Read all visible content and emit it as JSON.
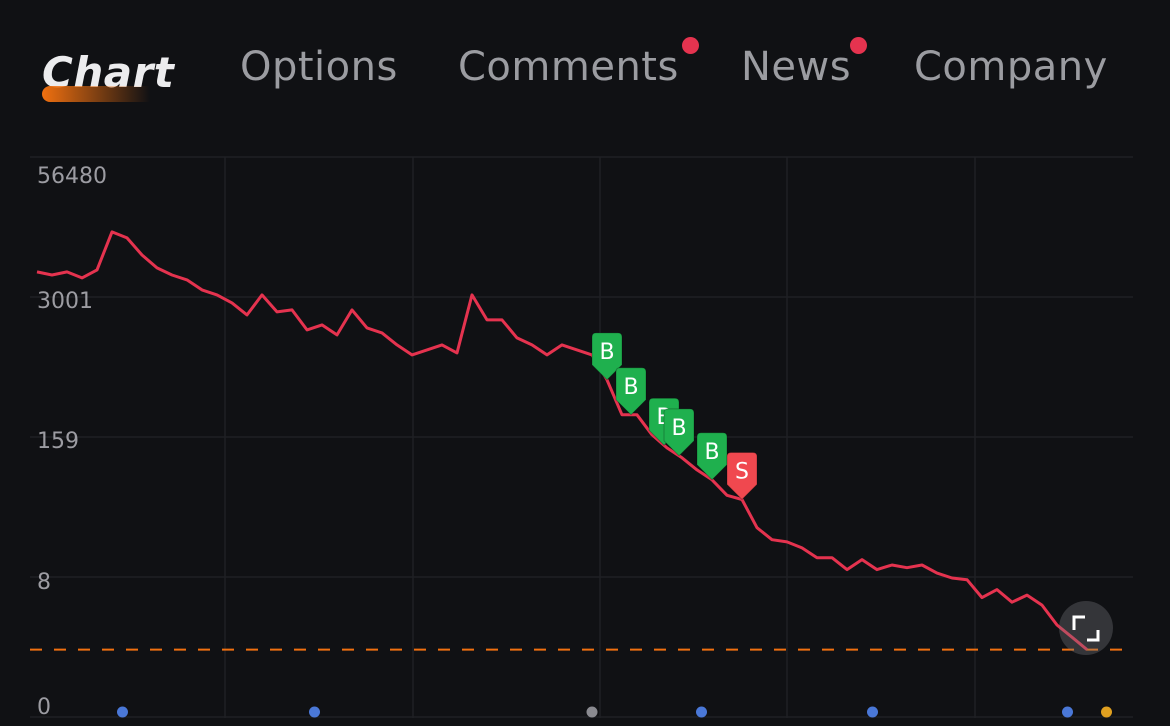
{
  "tabs": [
    {
      "label": "Chart",
      "active": true,
      "badge": false
    },
    {
      "label": "Options",
      "active": false,
      "badge": false
    },
    {
      "label": "Comments",
      "active": false,
      "badge": true
    },
    {
      "label": "News",
      "active": false,
      "badge": true
    },
    {
      "label": "Company",
      "active": false,
      "badge": false
    }
  ],
  "colors": {
    "line": "#e5334f",
    "buy": "#1fb04e",
    "sell": "#f0484f",
    "accent": "#f07010",
    "badge": "#e5334f",
    "grid": "#1f2024"
  },
  "fullscreen_button": {
    "icon": "expand-icon"
  },
  "chart_data": {
    "type": "line",
    "y_scale": "log",
    "y_ticks": [
      "56480",
      "3001",
      "159",
      "8",
      "0"
    ],
    "grid": true,
    "series": [
      {
        "values": [
          5075,
          4764,
          5075,
          4477,
          5297,
          11736,
          10350,
          7244,
          5521,
          4764,
          4294,
          3483,
          3134,
          2650,
          2061,
          3134,
          2195,
          2291,
          1506,
          1671,
          1355,
          2291,
          1570,
          1413,
          1099,
          891,
          990,
          1099,
          929,
          3134,
          1858,
          1858,
          1274,
          1099,
          891,
          1099,
          990,
          891,
          528,
          254,
          254,
          167,
          127,
          103,
          80,
          65,
          47,
          43,
          23.8,
          18.5,
          17.7,
          15.6,
          12.7,
          12.7,
          9.9,
          12.2,
          9.9,
          10.9,
          10.3,
          10.9,
          9.2,
          8.3,
          8.0,
          5.5,
          6.5,
          5.0,
          5.8,
          4.7,
          3.1,
          2.4,
          1.85
        ]
      }
    ],
    "reference_line": {
      "value": 1.85,
      "style": "dashed",
      "color": "#f07010"
    },
    "trade_markers": [
      {
        "index": 38,
        "label": "B",
        "type": "buy"
      },
      {
        "index": 39.6,
        "label": "B",
        "type": "buy"
      },
      {
        "index": 41.8,
        "label": "B",
        "type": "buy"
      },
      {
        "index": 42.8,
        "label": "B",
        "type": "buy"
      },
      {
        "index": 45,
        "label": "B",
        "type": "buy"
      },
      {
        "index": 47,
        "label": "S",
        "type": "sell"
      }
    ],
    "event_dots": [
      {
        "index": 5.7,
        "color": "#4a78d8"
      },
      {
        "index": 18.5,
        "color": "#4a78d8"
      },
      {
        "index": 37,
        "color": "#8a8a90"
      },
      {
        "index": 44.3,
        "color": "#4a78d8"
      },
      {
        "index": 55.7,
        "color": "#4a78d8"
      },
      {
        "index": 68.7,
        "color": "#4a78d8"
      },
      {
        "index": 71.3,
        "color": "#e0a020"
      }
    ]
  }
}
